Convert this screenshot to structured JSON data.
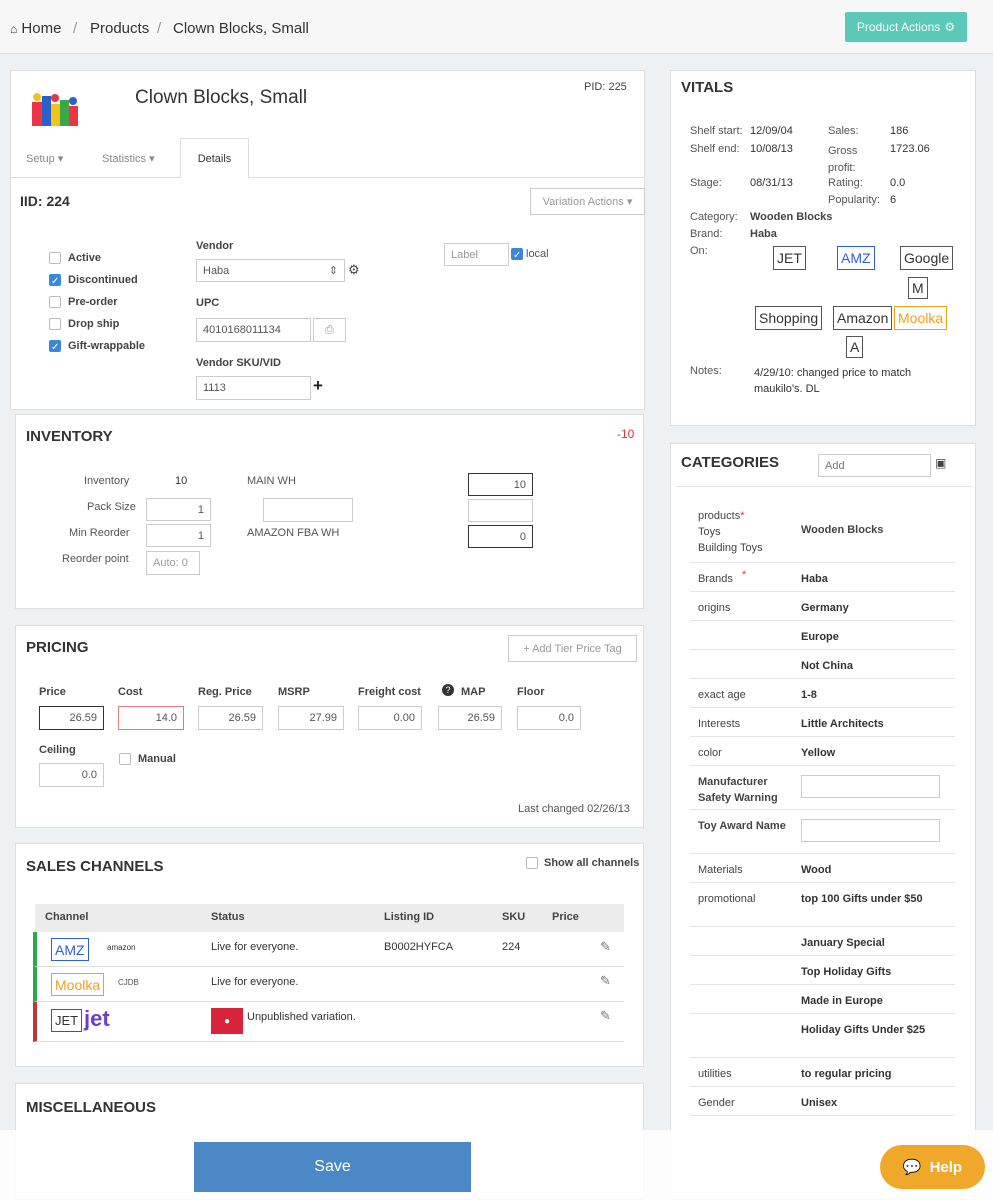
{
  "breadcrumb": {
    "home": "Home",
    "products": "Products",
    "current": "Clown Blocks, Small"
  },
  "header": {
    "product_actions": "Product Actions"
  },
  "product": {
    "name": "Clown Blocks, Small",
    "pid": "PID: 225",
    "iid": "IID: 224"
  },
  "tabs": {
    "setup": "Setup",
    "statistics": "Statistics",
    "details": "Details"
  },
  "variation_actions": "Variation Actions",
  "flags": [
    {
      "label": "Active",
      "checked": false
    },
    {
      "label": "Discontinued",
      "checked": true
    },
    {
      "label": "Pre-order",
      "checked": false
    },
    {
      "label": "Drop ship",
      "checked": false
    },
    {
      "label": "Gift-wrappable",
      "checked": true
    }
  ],
  "vendor": {
    "label": "Vendor",
    "value": "Haba",
    "upc_label": "UPC",
    "upc": "4010168011134",
    "sku_label": "Vendor SKU/VID",
    "sku": "1113",
    "label_placeholder": "Label",
    "local": "local"
  },
  "inventory": {
    "title": "INVENTORY",
    "delta": "-10",
    "inventory_label": "Inventory",
    "inventory_value": "10",
    "pack_size_label": "Pack Size",
    "pack_size": "1",
    "min_reorder_label": "Min Reorder",
    "min_reorder": "1",
    "reorder_point_label": "Reorder point",
    "reorder_point_placeholder": "Auto: 0",
    "main_wh": "MAIN WH",
    "main_wh_value": "10",
    "amazon_wh": "AMAZON FBA WH",
    "amazon_wh_value": "0"
  },
  "pricing": {
    "title": "PRICING",
    "add_tier": "+ Add Tier Price Tag",
    "fields": [
      {
        "label": "Price",
        "value": "26.59"
      },
      {
        "label": "Cost",
        "value": "14.0"
      },
      {
        "label": "Reg. Price",
        "value": "26.59"
      },
      {
        "label": "MSRP",
        "value": "27.99"
      },
      {
        "label": "Freight cost",
        "value": "0.00"
      },
      {
        "label": "MAP",
        "value": "26.59"
      },
      {
        "label": "Floor",
        "value": "0.0"
      }
    ],
    "ceiling_label": "Ceiling",
    "ceiling": "0.0",
    "manual": "Manual",
    "last_changed": "Last changed 02/26/13"
  },
  "sales_channels": {
    "title": "SALES CHANNELS",
    "show_all": "Show all channels",
    "headers": {
      "channel": "Channel",
      "status": "Status",
      "listing": "Listing ID",
      "sku": "SKU",
      "price": "Price"
    },
    "rows": [
      {
        "badge": "AMZ",
        "logo": "amazon",
        "status": "Live for everyone.",
        "listing": "B0002HYFCA",
        "sku": "224",
        "color": "#2aa84a",
        "badge_color": "#2f5fd0"
      },
      {
        "badge": "Moolka",
        "logo": "CJDB",
        "status": "Live for everyone.",
        "listing": "",
        "sku": "",
        "color": "#2aa84a",
        "badge_color": "#f0a020"
      },
      {
        "badge": "JET",
        "logo": "jet",
        "status": "Unpublished variation.",
        "listing": "",
        "sku": "",
        "color": "#b83a3a",
        "badge_color": "#333"
      }
    ]
  },
  "misc": {
    "title": "MISCELLANEOUS",
    "save": "Save"
  },
  "vitals": {
    "title": "VITALS",
    "shelf_start_label": "Shelf start:",
    "shelf_start": "12/09/04",
    "shelf_end_label": "Shelf end:",
    "shelf_end": "10/08/13",
    "stage_label": "Stage:",
    "stage": "08/31/13",
    "sales_label": "Sales:",
    "sales": "186",
    "gross_label": "Gross profit:",
    "gross": "1723.06",
    "rating_label": "Rating:",
    "rating": "0.0",
    "popularity_label": "Popularity:",
    "popularity": "6",
    "category_label": "Category:",
    "category": "Wooden Blocks",
    "brand_label": "Brand:",
    "brand": "Haba",
    "on_label": "On:",
    "channels": [
      "JET",
      "AMZ",
      "Google",
      "M",
      "Shopping",
      "Amazon",
      "Moolka",
      "A"
    ],
    "notes_label": "Notes:",
    "notes": "4/29/10: changed price to match maukilo's. DL"
  },
  "categories": {
    "title": "CATEGORIES",
    "add_placeholder": "Add",
    "rows": [
      {
        "key": "products",
        "key2": "Toys",
        "key3": "Building Toys",
        "value": "Wooden Blocks",
        "req": true
      },
      {
        "key": "Brands",
        "value": "Haba",
        "req": true
      },
      {
        "key": "origins",
        "value": "Germany"
      },
      {
        "key": "",
        "value": "Europe"
      },
      {
        "key": "",
        "value": "Not China"
      },
      {
        "key": "exact age",
        "value": "1-8"
      },
      {
        "key": "Interests",
        "value": "Little Architects"
      },
      {
        "key": "color",
        "value": "Yellow"
      },
      {
        "key": "Manufacturer Safety Warning",
        "value": "",
        "input": true
      },
      {
        "key": "Toy Award Name",
        "value": "",
        "input": true
      },
      {
        "key": "Materials",
        "value": "Wood"
      },
      {
        "key": "promotional",
        "value": "top 100 Gifts under $50"
      },
      {
        "key": "",
        "value": "January Special"
      },
      {
        "key": "",
        "value": "Top Holiday Gifts"
      },
      {
        "key": "",
        "value": "Made in Europe"
      },
      {
        "key": "",
        "value": "Holiday Gifts Under $25"
      },
      {
        "key": "utilities",
        "value": "to regular pricing"
      },
      {
        "key": "Gender",
        "value": "Unisex"
      }
    ]
  },
  "help": "Help"
}
